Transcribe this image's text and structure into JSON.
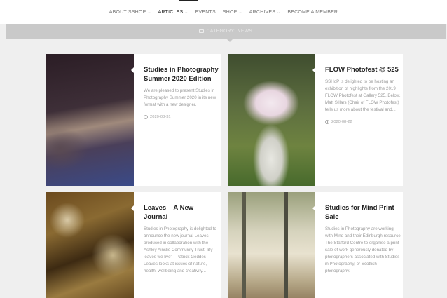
{
  "nav": {
    "items": [
      {
        "label": "ABOUT SSHOP",
        "has_dropdown": true,
        "active": false
      },
      {
        "label": "ARTICLES",
        "has_dropdown": true,
        "active": true
      },
      {
        "label": "EVENTS",
        "has_dropdown": false,
        "active": false
      },
      {
        "label": "SHOP",
        "has_dropdown": true,
        "active": false
      },
      {
        "label": "ARCHIVES",
        "has_dropdown": true,
        "active": false
      },
      {
        "label": "BECOME A MEMBER",
        "has_dropdown": false,
        "active": false
      }
    ]
  },
  "category_bar": {
    "icon": "folder-icon",
    "label": "CATEGORY: NEWS"
  },
  "articles": [
    {
      "title": "Studies in Photography Summer 2020 Edition",
      "excerpt": "We are pleased to present Studies in Photography Summer 2020 in its new format with a new designer.",
      "date": "2020-08-31"
    },
    {
      "title": "FLOW Photofest @ 525",
      "excerpt": "SSHoP is delighted to be hosting an exhibition of highlights from the 2019 FLOW Photofest at Gallery 525. Below, Matt Sillars (Chair of FLOW Photofest) tells us more about the festival and...",
      "date": "2020-08-22"
    },
    {
      "title": "Leaves – A New Journal",
      "excerpt": "Studies in Photography is delighted to announce the new journal Leaves, produced in collaboration with the Ashley Ainslie Community Trust. 'By leaves we live' – Patrick Geddes Leaves looks at issues of nature, health, wellbeing and creativity...",
      "date": ""
    },
    {
      "title": "Studies for Mind Print Sale",
      "excerpt": "Studies in Photography are working with Mind and their Edinburgh resource The Stafford Centre to organise a print sale of work generously donated by photographers associated with Studies in Photography, or Scottish photography.",
      "date": ""
    }
  ],
  "colors": {
    "page_bg": "#efefef",
    "category_bar": "#c9c9c9",
    "title": "#222222",
    "excerpt": "#9a9a9a"
  }
}
